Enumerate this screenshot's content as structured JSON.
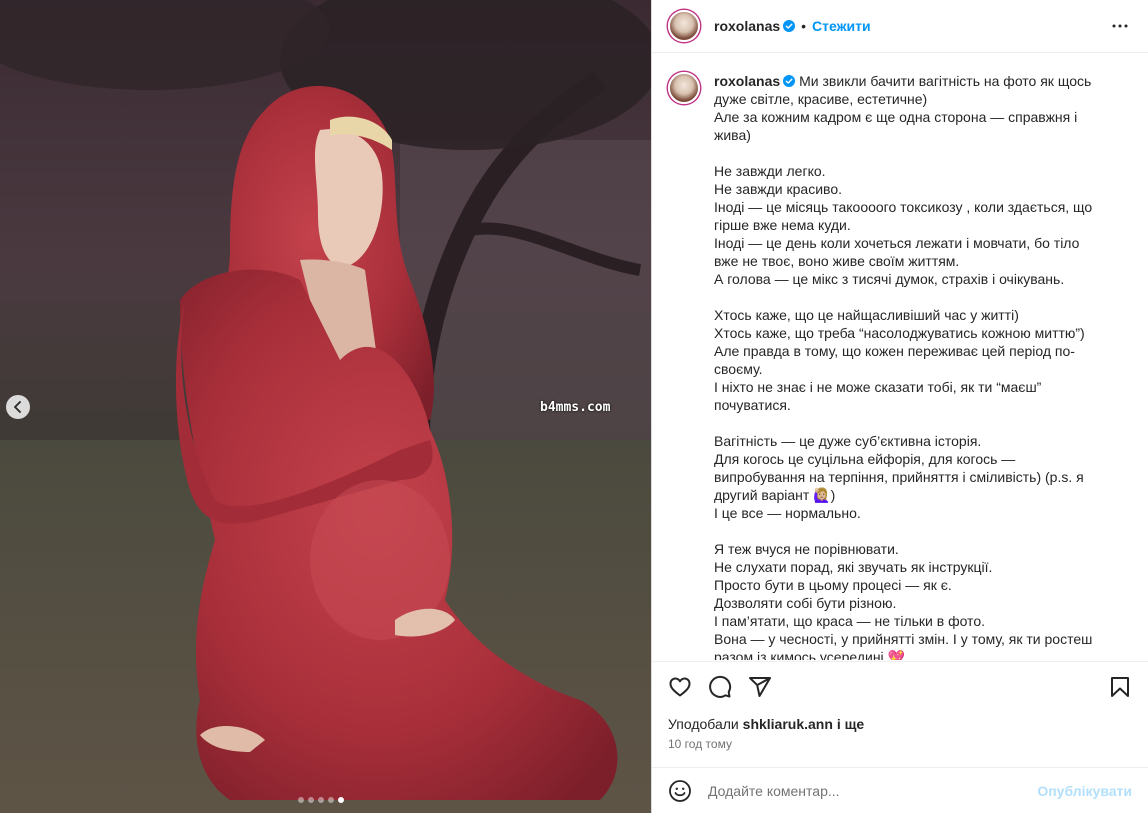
{
  "post": {
    "username": "roxolanas",
    "separator": "•",
    "follow_label": "Стежити",
    "watermark": "b4mms.com",
    "carousel": {
      "dot_count": 5,
      "active_index": 4
    }
  },
  "caption": {
    "username": "roxolanas",
    "lines": [
      "Ми звикли бачити вагітність на фото як щось дуже світле, красиве, естетичне)",
      "Але за кожним кадром є ще одна сторона — справжня і жива)",
      "",
      "Не завжди легко.",
      "Не завжди красиво.",
      "Іноді — це місяць такоооого токсикозу , коли здається, що гірше вже нема куди.",
      "Іноді — це день коли хочеться лежати і мовчати, бо тіло вже не твоє, воно живе своїм життям.",
      "А голова — це мікс з тисячі думок, страхів і очікувань.",
      "",
      "Хтось каже, що це найщасливіший час у житті)",
      "Хтось каже, що треба “насолоджуватись кожною миттю”)",
      "Але правда в тому, що кожен переживає цей період по-своєму.",
      "І ніхто не знає і не може сказати тобі, як ти “маєш” почуватися.",
      "",
      "Вагітність — це дуже суб’єктивна історія.",
      "Для когось це суцільна ейфорія, для когось — випробування на терпіння, прийняття і сміливість) (p.s. я другий варіант 🙋🏼‍♀️)",
      "І це все — нормально.",
      "",
      "Я теж вчуся не порівнювати.",
      "Не слухати порад, які звучать як інструкції.",
      "Просто бути в цьому процесі — як є.",
      "Дозволяти собі бути різною.",
      "І пам’ятати, що краса — не тільки в фото.",
      "Вона — у чесності, у прийнятті змін. І у тому, як ти ростеш разом із кимось усередині 💖",
      "",
      "✨"
    ]
  },
  "likes": {
    "prefix": "Уподобали",
    "user": "shkliaruk.ann",
    "suffix": "і ще"
  },
  "timestamp": "10 год тому",
  "comment": {
    "placeholder": "Додайте коментар...",
    "post_label": "Опублікувати"
  },
  "colors": {
    "accent": "#0095f6",
    "post_disabled": "#b2dffc",
    "verified": "#0095f6",
    "dress": "#b8353f"
  },
  "icons": [
    "chevron-left-icon",
    "verified-badge-icon",
    "more-options-icon",
    "heart-icon",
    "comment-icon",
    "share-icon",
    "bookmark-icon",
    "emoji-icon"
  ]
}
